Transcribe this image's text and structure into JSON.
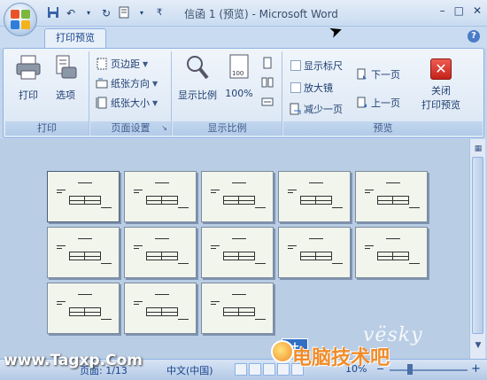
{
  "window": {
    "title": "信函 1 (预览) - Microsoft Word",
    "controls": [
      "–",
      "□",
      "✕"
    ]
  },
  "tabs": {
    "active": "打印预览"
  },
  "ribbon": {
    "groups": {
      "print": {
        "label": "打印",
        "print_btn": "打印",
        "options_btn": "选项"
      },
      "page_setup": {
        "label": "页面设置",
        "margins": "页边距",
        "orientation": "纸张方向",
        "size": "纸张大小"
      },
      "zoom": {
        "label": "显示比例",
        "zoom_btn": "显示比例",
        "hundred": "100%"
      },
      "preview": {
        "label": "预览",
        "show_ruler": "显示标尺",
        "magnifier": "放大镜",
        "shrink_one_page": "减少一页",
        "next_page": "下一页",
        "prev_page": "上一页",
        "close_preview_line1": "关闭",
        "close_preview_line2": "打印预览"
      }
    }
  },
  "document": {
    "page_count": 13
  },
  "statusbar": {
    "page_info": "页面: 1/13",
    "language": "中文(中国)",
    "zoom": "10%"
  },
  "watermarks": {
    "left": "www.Tagxp.Com",
    "vesky": "vësky",
    "right": "电脑技术吧"
  },
  "colors": {
    "accent": "#15428b",
    "ribbon_bg": "#dae6f4",
    "doc_bg": "#b9cde5",
    "close_red": "#d9342b"
  }
}
